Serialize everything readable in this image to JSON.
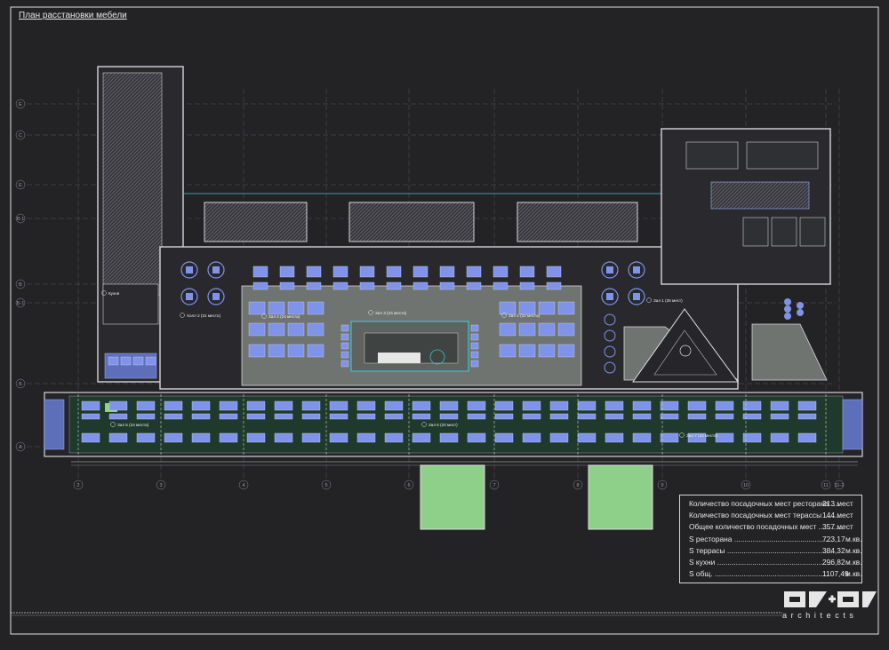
{
  "title": "План расстановки мебели",
  "axes": {
    "columns": [
      "2",
      "3",
      "4",
      "5",
      "6",
      "7",
      "8",
      "9",
      "10",
      "11",
      "11-2"
    ],
    "rows": [
      "E",
      "C",
      "E",
      "B-1",
      "B",
      "Б-1",
      "Б",
      "A"
    ]
  },
  "rooms": [
    {
      "text": "Кухня"
    },
    {
      "text": "Холл 2 (31 место)"
    },
    {
      "text": "Зал 4 (24 места)"
    },
    {
      "text": "Зал 3 (24 места)"
    },
    {
      "text": "Зал 2 (32 места)"
    },
    {
      "text": "Зал 1 (36 мест)"
    },
    {
      "text": "Зал 5 (24 места)"
    },
    {
      "text": "Зал 6 (20 мест)"
    },
    {
      "text": "Зал 7 (42 места)"
    }
  ],
  "stats": [
    {
      "label": "Количество посадочных мест ресторана ....",
      "value": "213 мест",
      "unit": ""
    },
    {
      "label": "Количество посадочных мест терассы .........",
      "value": "144 мест",
      "unit": ""
    },
    {
      "label": "Общее количество посадочных мест ............",
      "value": "357 мест",
      "unit": ""
    },
    {
      "label": "S ресторана ................................................",
      "value": "723,17",
      "unit": "м.кв."
    },
    {
      "label": "S террасы ....................................................",
      "value": "384,32",
      "unit": "м.кв."
    },
    {
      "label": "S кухни ........................................................",
      "value": "296,82",
      "unit": "м.кв."
    },
    {
      "label": "S общ. ........................................................",
      "value": "1107,49",
      "unit": "м.кв."
    }
  ],
  "logo": {
    "text": "architects"
  },
  "colors": {
    "background": "#232326",
    "wall": "#d6d6da",
    "furniture": "#7f93e8",
    "hall_fill": "#6f7471",
    "terrace_fill": "#1f3a2c",
    "green": "#8ed08a",
    "cyan": "#3fc0c8",
    "grid": "#5a5a62"
  }
}
